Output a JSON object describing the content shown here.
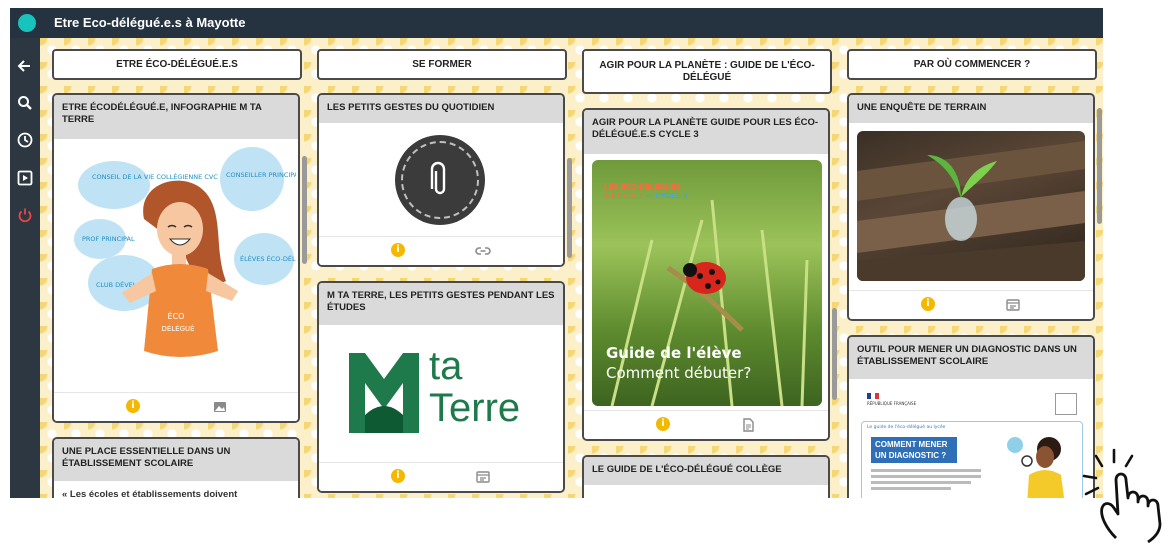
{
  "app": {
    "title": "Etre Eco-délégué.e.s à Mayotte"
  },
  "columns": [
    {
      "title": "ETRE ÉCO-DÉLÉGUÉ.E.S"
    },
    {
      "title": "SE FORMER"
    },
    {
      "title": "AGIR POUR LA PLANÈTE : GUIDE DE L'ÉCO-DÉLÉGUÉ"
    },
    {
      "title": "PAR OÙ COMMENCER ?"
    }
  ],
  "cards": {
    "infographie": {
      "title": "ETRE ÉCODÉLÉGUÉ.E, INFOGRAPHIE M TA TERRE",
      "bubbles": [
        "CONSEIL DE LA VIE COLLÉGIENNE CVC",
        "CONSEILLER PRINCIPAL D'ÉDUCATION CPE",
        "PROF PRINCIPAL",
        "ÉLÈVES ÉCO-DÉLÉGUÉS",
        "CLUB DÉVELOPPEMENT DURABLE"
      ],
      "shirt_text": [
        "ÉCO",
        "DÉLÉGUÉ"
      ]
    },
    "place": {
      "title": "UNE PLACE ESSENTIELLE DANS UN ÉTABLISSEMENT SCOLAIRE",
      "body": "« Les écoles et établissements doivent"
    },
    "gestes": {
      "title": "LES PETITS GESTES DU QUOTIDIEN"
    },
    "mtaterre": {
      "title": "M TA TERRE, LES PETITS GESTES PENDANT LES ÉTUDES",
      "logo_line1": "ta",
      "logo_line2": "Terre"
    },
    "agir": {
      "title": "AGIR POUR LA PLANÈTE GUIDE POUR LES ÉCO-DÉLÉGUÉ.E.S CYCLE 3",
      "cover_tag1": "LES ÉCO-DÉLÉGUÉS",
      "cover_tag2": "À L'ÉCOLE",
      "cover_tag3": "CYCLE 3",
      "cover_title1": "Guide de l'élève",
      "cover_title2": "Comment débuter?"
    },
    "guide_college": {
      "title": "LE GUIDE DE L'ÉCO-DÉLÉGUÉ COLLÈGE"
    },
    "enquete": {
      "title": "UNE ENQUÊTE DE TERRAIN"
    },
    "diagnostic": {
      "title": "OUTIL POUR MENER UN DIAGNOSTIC DANS UN ÉTABLISSEMENT SCOLAIRE",
      "republique": "RÉPUBLIQUE FRANÇAISE",
      "doc_header": "Le guide de l'éco-délégué au lycée",
      "doc_banner1": "COMMENT MENER",
      "doc_banner2": "UN DIAGNOSTIC ?"
    }
  },
  "footer_info_glyph": "i",
  "colors": {
    "topbar": "#253240",
    "sidebar": "#2d3742",
    "accent": "#19c3bd",
    "info": "#f5b800",
    "board": "#fbf0c9"
  }
}
